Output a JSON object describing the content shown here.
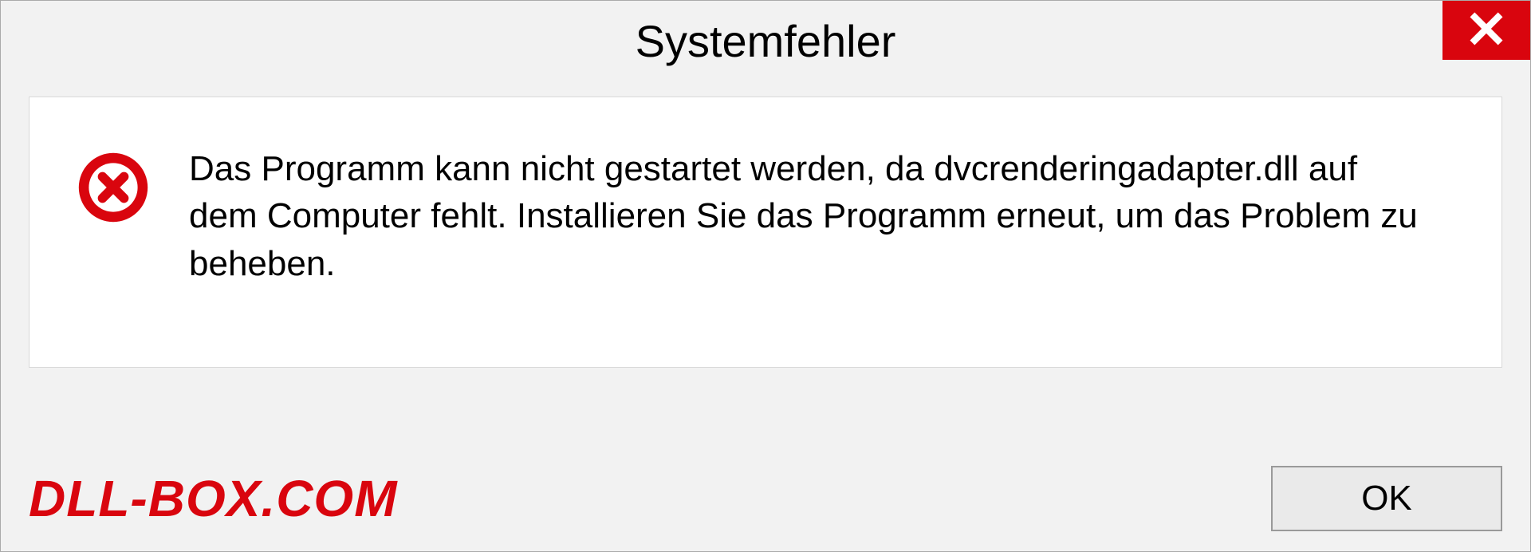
{
  "dialog": {
    "title": "Systemfehler",
    "message": "Das Programm kann nicht gestartet werden, da dvcrenderingadapter.dll auf dem Computer fehlt. Installieren Sie das Programm erneut, um das Problem zu beheben.",
    "ok_label": "OK"
  },
  "watermark": "DLL-BOX.COM"
}
